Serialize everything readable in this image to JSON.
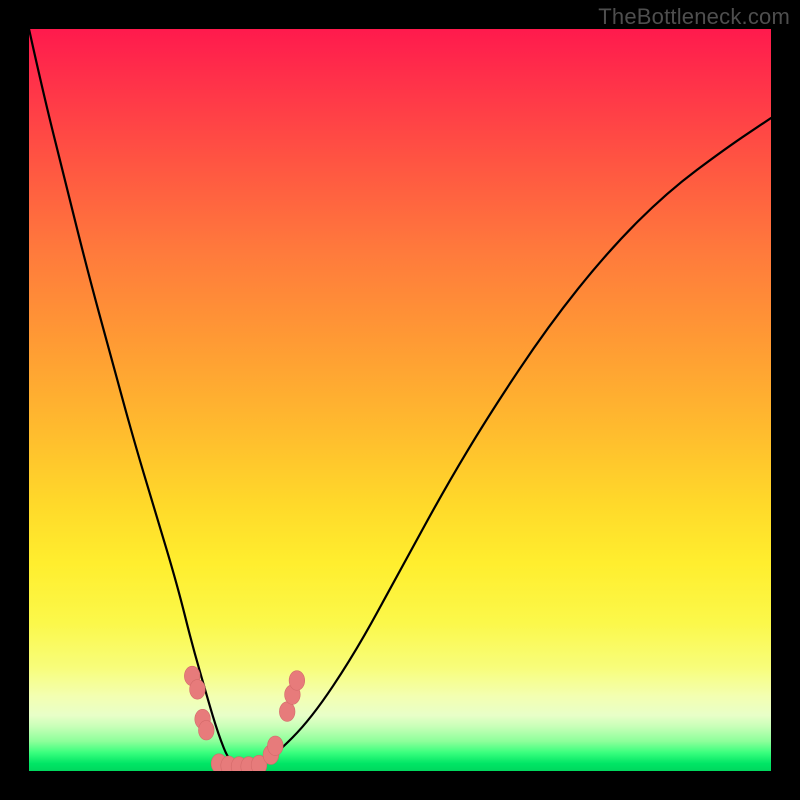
{
  "watermark": {
    "text": "TheBottleneck.com"
  },
  "colors": {
    "frame": "#000000",
    "curve": "#000000",
    "marker_fill": "#e77b7b",
    "marker_stroke": "#d46a6a",
    "gradient_stops": [
      "#ff1a4d",
      "#ff9a34",
      "#ffee2e",
      "#f3ffb2",
      "#00e565"
    ]
  },
  "chart_data": {
    "type": "line",
    "title": "",
    "xlabel": "",
    "ylabel": "",
    "xlim": [
      0,
      100
    ],
    "ylim": [
      0,
      100
    ],
    "notes": "V-shaped bottleneck curve over a vertical red→green gradient background. No axis ticks or numeric labels are rendered; values below are visual estimates in percent of plot area (x left→right, y bottom→top).",
    "series": [
      {
        "name": "bottleneck-curve",
        "x": [
          0,
          2,
          5,
          8,
          11,
          14,
          17,
          20,
          22,
          24,
          25.5,
          27,
          29,
          30.5,
          33,
          38,
          44,
          50,
          56,
          62,
          70,
          78,
          86,
          94,
          100
        ],
        "y": [
          100,
          91,
          79,
          67,
          56,
          45,
          35,
          25,
          17,
          10,
          5,
          1.2,
          0.4,
          0.6,
          2,
          7,
          16,
          27,
          38,
          48,
          60,
          70,
          78,
          84,
          88
        ]
      }
    ],
    "markers": {
      "name": "highlighted-points",
      "points": [
        {
          "x": 22.0,
          "y": 12.8
        },
        {
          "x": 22.7,
          "y": 11.0
        },
        {
          "x": 23.4,
          "y": 7.0
        },
        {
          "x": 23.9,
          "y": 5.5
        },
        {
          "x": 25.6,
          "y": 1.0
        },
        {
          "x": 26.9,
          "y": 0.7
        },
        {
          "x": 28.3,
          "y": 0.6
        },
        {
          "x": 29.6,
          "y": 0.6
        },
        {
          "x": 31.0,
          "y": 0.8
        },
        {
          "x": 32.6,
          "y": 2.2
        },
        {
          "x": 33.2,
          "y": 3.4
        },
        {
          "x": 34.8,
          "y": 8.0
        },
        {
          "x": 35.5,
          "y": 10.3
        },
        {
          "x": 36.1,
          "y": 12.2
        }
      ]
    }
  }
}
